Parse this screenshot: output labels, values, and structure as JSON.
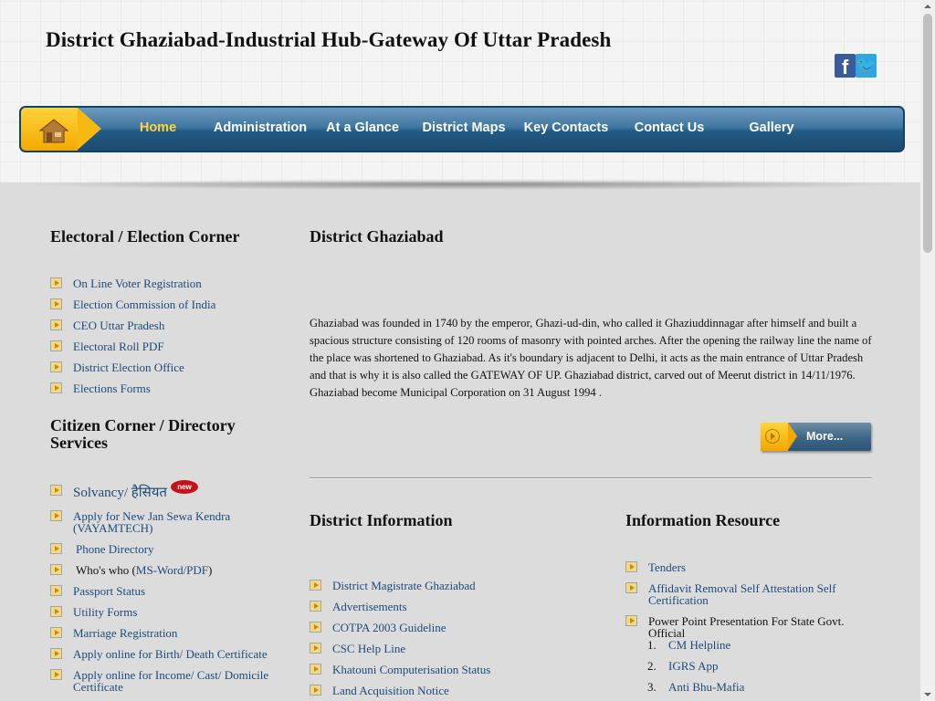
{
  "header": {
    "title": "District Ghaziabad-Industrial Hub-Gateway Of Uttar Pradesh",
    "social": {
      "facebook": "f",
      "twitter": "🐦"
    }
  },
  "nav": {
    "items": [
      {
        "label": "Home"
      },
      {
        "label": "Administration"
      },
      {
        "label": "At a Glance"
      },
      {
        "label": "District Maps"
      },
      {
        "label": "Key Contacts"
      },
      {
        "label": "Contact Us"
      },
      {
        "label": "Gallery"
      }
    ]
  },
  "electoral": {
    "heading": "Electoral / Election Corner",
    "links": [
      "On Line Voter Registration",
      "Election Commission of India",
      "CEO Uttar Pradesh",
      "Electoral Roll PDF",
      "District Election Office",
      "Elections Forms"
    ]
  },
  "citizen": {
    "heading_line1": "Citizen Corner / Directory",
    "heading_line2": "Services",
    "solvancy": "Solvancy/ हैसियत",
    "new_badge": "new",
    "jan_sewa_line1": "Apply for New Jan Sewa Kendra",
    "jan_sewa_line2": "(VAYAMTECH)",
    "phone_directory": "Phone Directory",
    "whos_who_prefix": "Who's who (",
    "whos_who_link": "MS-Word/PDF",
    "whos_who_suffix": ")",
    "passport": "Passport Status",
    "utility": "Utility Forms",
    "marriage": "Marriage Registration",
    "birth": "Apply online for Birth/ Death Certificate",
    "income_line1": "Apply online for Income/ Cast/ Domicile",
    "income_line2": "Certificate"
  },
  "district": {
    "heading": "District Ghaziabad",
    "intro": "Ghaziabad was founded in 1740 by the emperor, Ghazi-ud-din, who called it Ghaziuddinnagar after himself and built a spacious structure consisting of 120 rooms of masonry with pointed arches. After the opening the railway line the name of the place was shortened to Ghaziabad. As it's boundary is adjacent to Delhi, it acts as the main entrance of Uttar Pradesh and that is why it is also called the GATEWAY OF UP. Ghaziabad district, carved out of Meerut district in 14/11/1976.  Ghaziabad become Municipal Corporation on 31 August 1994 .",
    "more_label": "More..."
  },
  "district_info": {
    "heading": "District Information",
    "links": [
      "District Magistrate Ghaziabad",
      "Advertisements",
      "COTPA 2003 Guideline",
      "CSC Help Line",
      "Khatouni Computerisation Status",
      "Land Acquisition Notice"
    ]
  },
  "info_resource": {
    "heading": "Information Resource",
    "tenders": "Tenders",
    "affidavit_line1": "Affidavit Removal Self Attestation Self",
    "affidavit_line2": "Certification",
    "ppt_line1": "Power Point Presentation For State Govt.",
    "ppt_line2": "Official",
    "sub_items": [
      {
        "num": "1.",
        "label": "CM Helpline"
      },
      {
        "num": "2.",
        "label": "IGRS App"
      },
      {
        "num": "3.",
        "label": "Anti Bhu-Mafia"
      }
    ]
  }
}
